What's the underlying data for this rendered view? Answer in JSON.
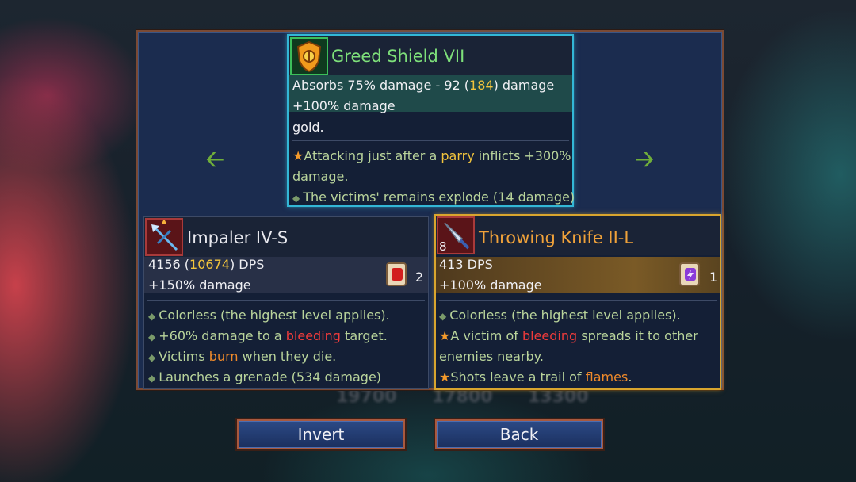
{
  "background": {
    "amounts": [
      "19700",
      "17800",
      "13300"
    ]
  },
  "top_item": {
    "name": "Greed Shield VII",
    "icon": "greed-shield-icon",
    "stat_line1_pre": "Absorbs 75% damage - 92 (",
    "stat_line1_highlight": "184",
    "stat_line1_post": ") damage",
    "stat_line2": "+100% damage",
    "stat_line3": "gold.",
    "affix1_pre": "Attacking just after a ",
    "affix1_highlight": "parry",
    "affix1_post": " inflicts +300%",
    "affix1_cont": "damage.",
    "affix2": "The victims' remains explode (14 damage)"
  },
  "left_item": {
    "name": "Impaler IV-S",
    "icon": "impaler-crossbow-icon",
    "dps_pre": "4156 (",
    "dps_highlight": "10674",
    "dps_post": ") DPS",
    "damage": "+150% damage",
    "scroll_icon": "brutality-scroll-icon",
    "scroll_count": "2",
    "affix1": "Colorless (the highest level applies).",
    "affix2_pre": "+60% damage to a ",
    "affix2_highlight": "bleeding",
    "affix2_post": " target.",
    "affix3_pre": "Victims ",
    "affix3_highlight": "burn",
    "affix3_post": " when they die.",
    "affix4": "Launches a grenade (534 damage)"
  },
  "right_item": {
    "name": "Throwing Knife II-L",
    "icon": "throwing-knife-icon",
    "icon_badge": "8",
    "dps": "413 DPS",
    "damage": "+100% damage",
    "scroll_icon": "tactics-scroll-icon",
    "scroll_count": "1",
    "affix1": "Colorless (the highest level applies).",
    "affix2_pre": "A victim of ",
    "affix2_highlight": "bleeding",
    "affix2_post": " spreads it to other",
    "affix2_cont": "enemies nearby.",
    "affix3_pre": "Shots leave a trail of ",
    "affix3_highlight": "flames",
    "affix3_post": "."
  },
  "buttons": {
    "invert": "Invert",
    "back": "Back"
  },
  "colors": {
    "accent_green": "#6fae3a",
    "highlight_gold": "#f2c43c",
    "bleed_red": "#ef3b3b",
    "selected_gold": "#d9a52e",
    "top_border": "#33b7d6"
  }
}
